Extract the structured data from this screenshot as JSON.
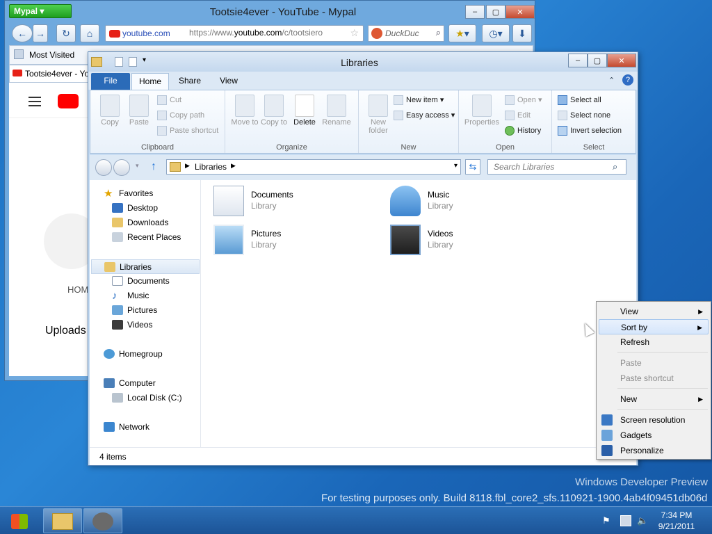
{
  "browser": {
    "menu_button": "Mypal",
    "title": "Tootsie4ever - YouTube - Mypal",
    "url_site_chip": "youtube.com",
    "url_prefix": "https://www.",
    "url_host": "youtube.com",
    "url_path": "/c/tootsiero",
    "search_placeholder": "DuckDuc",
    "bookmark_most_visited": "Most Visited",
    "tab_label": "Tootsie4ever - Yo",
    "page_home": "HOM",
    "page_uploads": "Uploads"
  },
  "explorer": {
    "title": "Libraries",
    "tabs": [
      "File",
      "Home",
      "Share",
      "View"
    ],
    "ribbon": {
      "clipboard": {
        "label": "Clipboard",
        "copy": "Copy",
        "paste": "Paste",
        "cut": "Cut",
        "copy_path": "Copy path",
        "paste_shortcut": "Paste shortcut"
      },
      "organize": {
        "label": "Organize",
        "move_to": "Move to",
        "copy_to": "Copy to",
        "delete": "Delete",
        "rename": "Rename"
      },
      "new": {
        "label": "New",
        "new_folder": "New folder",
        "new_item": "New item",
        "easy_access": "Easy access"
      },
      "open": {
        "label": "Open",
        "properties": "Properties",
        "open": "Open",
        "edit": "Edit",
        "history": "History"
      },
      "select": {
        "label": "Select",
        "select_all": "Select all",
        "select_none": "Select none",
        "invert_selection": "Invert selection"
      }
    },
    "breadcrumb": "Libraries",
    "search_placeholder": "Search Libraries",
    "nav": {
      "favorites": "Favorites",
      "desktop": "Desktop",
      "downloads": "Downloads",
      "recent_places": "Recent Places",
      "libraries": "Libraries",
      "documents": "Documents",
      "music": "Music",
      "pictures": "Pictures",
      "videos": "Videos",
      "homegroup": "Homegroup",
      "computer": "Computer",
      "local_disk": "Local Disk (C:)",
      "network": "Network"
    },
    "libraries": [
      {
        "name": "Documents",
        "type": "Library"
      },
      {
        "name": "Music",
        "type": "Library"
      },
      {
        "name": "Pictures",
        "type": "Library"
      },
      {
        "name": "Videos",
        "type": "Library"
      }
    ],
    "status": "4 items"
  },
  "context_menu": {
    "view": "View",
    "sort_by": "Sort by",
    "refresh": "Refresh",
    "paste": "Paste",
    "paste_shortcut": "Paste shortcut",
    "new": "New",
    "screen_resolution": "Screen resolution",
    "gadgets": "Gadgets",
    "personalize": "Personalize"
  },
  "watermark": {
    "line1": "Windows Developer Preview",
    "line2": "For testing purposes only. Build 8118.fbl_core2_sfs.110921-1900.4ab4f09451db06dc"
  },
  "taskbar": {
    "time": "7:34 PM",
    "date": "9/21/2011"
  }
}
